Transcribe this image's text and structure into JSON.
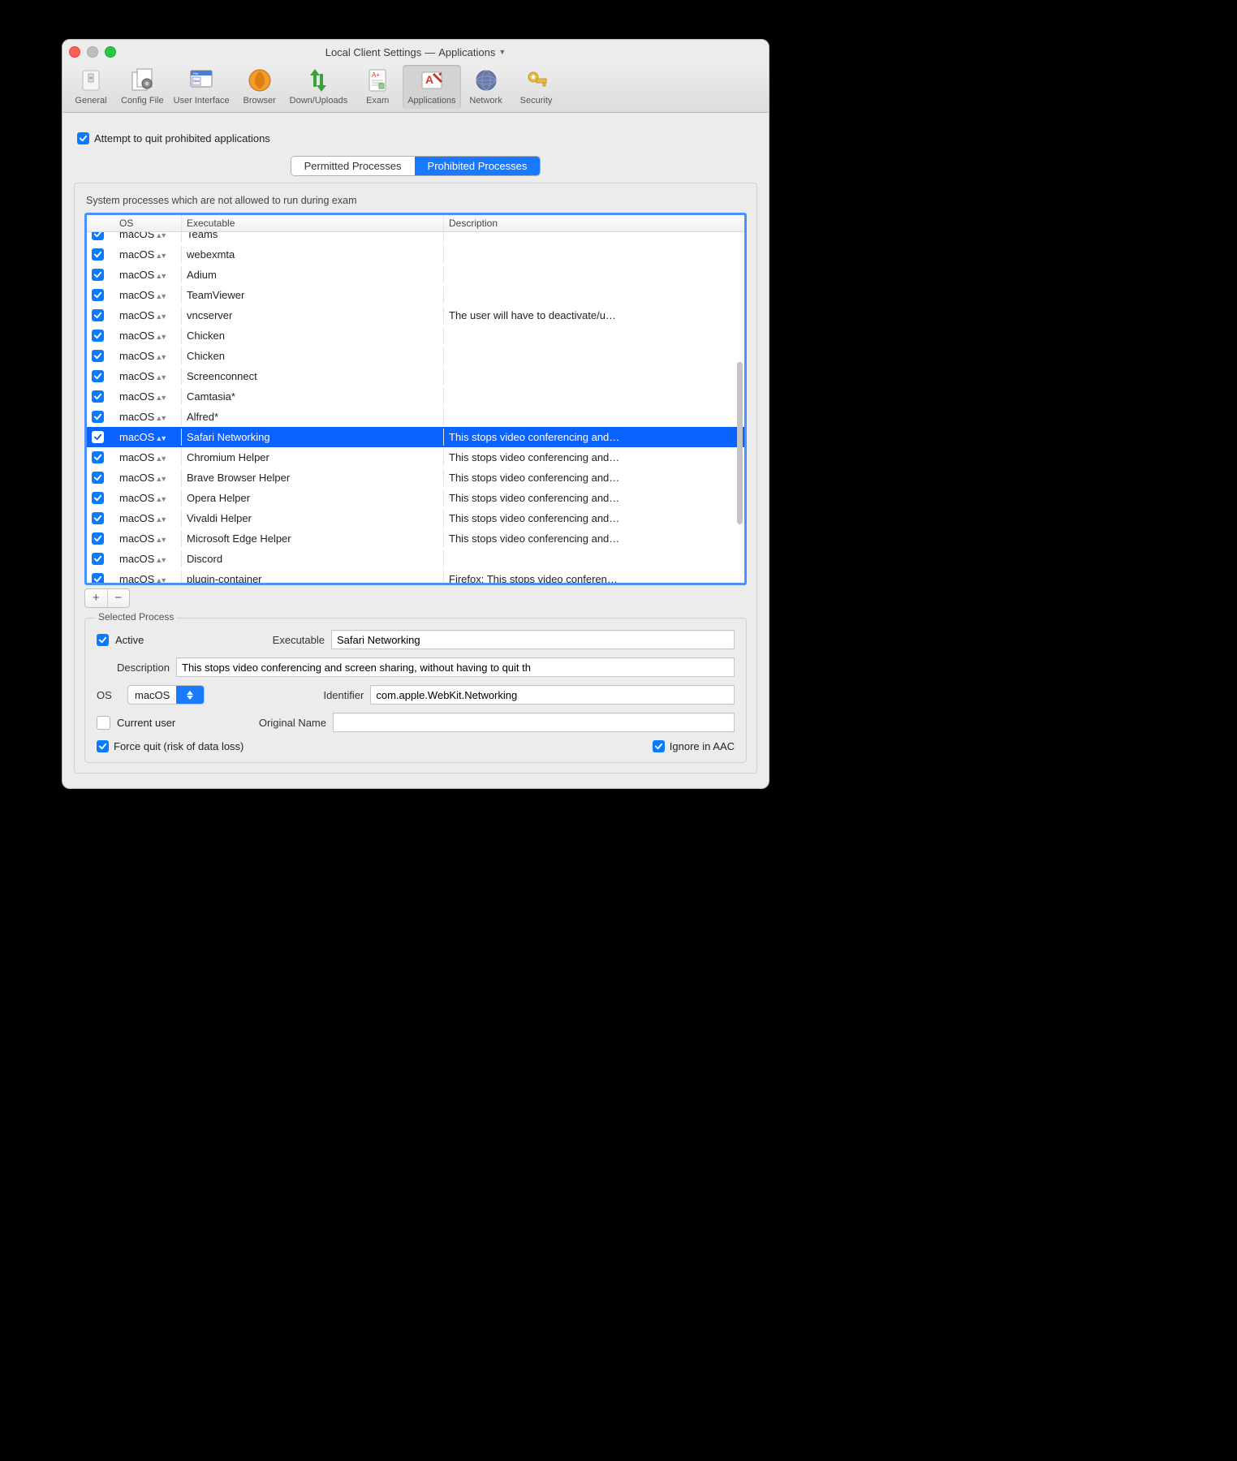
{
  "window": {
    "title_left": "Local Client Settings",
    "title_sep": "—",
    "title_right": "Applications"
  },
  "toolbar": [
    {
      "key": "general",
      "label": "General"
    },
    {
      "key": "config",
      "label": "Config File"
    },
    {
      "key": "ui",
      "label": "User Interface"
    },
    {
      "key": "browser",
      "label": "Browser"
    },
    {
      "key": "updown",
      "label": "Down/Uploads"
    },
    {
      "key": "exam",
      "label": "Exam"
    },
    {
      "key": "apps",
      "label": "Applications",
      "active": true
    },
    {
      "key": "network",
      "label": "Network"
    },
    {
      "key": "security",
      "label": "Security"
    }
  ],
  "main": {
    "attempt_quit_label": "Attempt to quit prohibited applications",
    "attempt_quit_checked": true,
    "tabs": {
      "permitted": "Permitted Processes",
      "prohibited": "Prohibited Processes",
      "active": "prohibited"
    },
    "panel_desc": "System processes which are not allowed to run during exam",
    "columns": {
      "os": "OS",
      "exe": "Executable",
      "desc": "Description"
    },
    "rows": [
      {
        "ck": true,
        "os": "macOS",
        "exe": "Teams",
        "desc": "",
        "cut": true
      },
      {
        "ck": true,
        "os": "macOS",
        "exe": "webexmta",
        "desc": ""
      },
      {
        "ck": true,
        "os": "macOS",
        "exe": "Adium",
        "desc": ""
      },
      {
        "ck": true,
        "os": "macOS",
        "exe": "TeamViewer",
        "desc": ""
      },
      {
        "ck": true,
        "os": "macOS",
        "exe": "vncserver",
        "desc": "The user will have to deactivate/u…"
      },
      {
        "ck": true,
        "os": "macOS",
        "exe": "Chicken",
        "desc": ""
      },
      {
        "ck": true,
        "os": "macOS",
        "exe": "Chicken",
        "desc": ""
      },
      {
        "ck": true,
        "os": "macOS",
        "exe": "Screenconnect",
        "desc": ""
      },
      {
        "ck": true,
        "os": "macOS",
        "exe": "Camtasia*",
        "desc": ""
      },
      {
        "ck": true,
        "os": "macOS",
        "exe": "Alfred*",
        "desc": ""
      },
      {
        "ck": true,
        "os": "macOS",
        "exe": "Safari Networking",
        "desc": "This stops video conferencing and…",
        "selected": true
      },
      {
        "ck": true,
        "os": "macOS",
        "exe": "Chromium Helper",
        "desc": "This stops video conferencing and…"
      },
      {
        "ck": true,
        "os": "macOS",
        "exe": "Brave Browser Helper",
        "desc": "This stops video conferencing and…"
      },
      {
        "ck": true,
        "os": "macOS",
        "exe": "Opera Helper",
        "desc": "This stops video conferencing and…"
      },
      {
        "ck": true,
        "os": "macOS",
        "exe": "Vivaldi Helper",
        "desc": "This stops video conferencing and…"
      },
      {
        "ck": true,
        "os": "macOS",
        "exe": "Microsoft Edge Helper",
        "desc": "This stops video conferencing and…"
      },
      {
        "ck": true,
        "os": "macOS",
        "exe": "Discord",
        "desc": ""
      },
      {
        "ck": true,
        "os": "macOS",
        "exe": "plugin-container",
        "desc": "Firefox: This stops video conferen…"
      }
    ],
    "add_label": "+",
    "remove_label": "−"
  },
  "detail": {
    "group_title": "Selected Process",
    "active_label": "Active",
    "active_checked": true,
    "executable_label": "Executable",
    "executable_value": "Safari Networking",
    "description_label": "Description",
    "description_value": "This stops video conferencing and screen sharing, without having to quit th",
    "os_label": "OS",
    "os_value": "macOS",
    "identifier_label": "Identifier",
    "identifier_value": "com.apple.WebKit.Networking",
    "current_user_label": "Current user",
    "current_user_checked": false,
    "original_name_label": "Original Name",
    "original_name_value": "",
    "force_quit_label": "Force quit (risk of data loss)",
    "force_quit_checked": true,
    "ignore_aac_label": "Ignore in AAC",
    "ignore_aac_checked": true
  }
}
